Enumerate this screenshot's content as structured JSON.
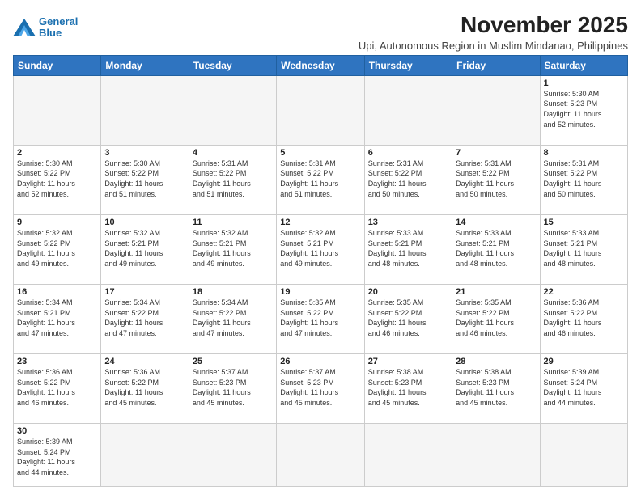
{
  "logo": {
    "line1": "General",
    "line2": "Blue"
  },
  "title": "November 2025",
  "subtitle": "Upi, Autonomous Region in Muslim Mindanao, Philippines",
  "weekdays": [
    "Sunday",
    "Monday",
    "Tuesday",
    "Wednesday",
    "Thursday",
    "Friday",
    "Saturday"
  ],
  "weeks": [
    [
      {
        "day": "",
        "info": ""
      },
      {
        "day": "",
        "info": ""
      },
      {
        "day": "",
        "info": ""
      },
      {
        "day": "",
        "info": ""
      },
      {
        "day": "",
        "info": ""
      },
      {
        "day": "",
        "info": ""
      },
      {
        "day": "1",
        "info": "Sunrise: 5:30 AM\nSunset: 5:23 PM\nDaylight: 11 hours\nand 52 minutes."
      }
    ],
    [
      {
        "day": "2",
        "info": "Sunrise: 5:30 AM\nSunset: 5:22 PM\nDaylight: 11 hours\nand 52 minutes."
      },
      {
        "day": "3",
        "info": "Sunrise: 5:30 AM\nSunset: 5:22 PM\nDaylight: 11 hours\nand 51 minutes."
      },
      {
        "day": "4",
        "info": "Sunrise: 5:31 AM\nSunset: 5:22 PM\nDaylight: 11 hours\nand 51 minutes."
      },
      {
        "day": "5",
        "info": "Sunrise: 5:31 AM\nSunset: 5:22 PM\nDaylight: 11 hours\nand 51 minutes."
      },
      {
        "day": "6",
        "info": "Sunrise: 5:31 AM\nSunset: 5:22 PM\nDaylight: 11 hours\nand 50 minutes."
      },
      {
        "day": "7",
        "info": "Sunrise: 5:31 AM\nSunset: 5:22 PM\nDaylight: 11 hours\nand 50 minutes."
      },
      {
        "day": "8",
        "info": "Sunrise: 5:31 AM\nSunset: 5:22 PM\nDaylight: 11 hours\nand 50 minutes."
      }
    ],
    [
      {
        "day": "9",
        "info": "Sunrise: 5:32 AM\nSunset: 5:22 PM\nDaylight: 11 hours\nand 49 minutes."
      },
      {
        "day": "10",
        "info": "Sunrise: 5:32 AM\nSunset: 5:21 PM\nDaylight: 11 hours\nand 49 minutes."
      },
      {
        "day": "11",
        "info": "Sunrise: 5:32 AM\nSunset: 5:21 PM\nDaylight: 11 hours\nand 49 minutes."
      },
      {
        "day": "12",
        "info": "Sunrise: 5:32 AM\nSunset: 5:21 PM\nDaylight: 11 hours\nand 49 minutes."
      },
      {
        "day": "13",
        "info": "Sunrise: 5:33 AM\nSunset: 5:21 PM\nDaylight: 11 hours\nand 48 minutes."
      },
      {
        "day": "14",
        "info": "Sunrise: 5:33 AM\nSunset: 5:21 PM\nDaylight: 11 hours\nand 48 minutes."
      },
      {
        "day": "15",
        "info": "Sunrise: 5:33 AM\nSunset: 5:21 PM\nDaylight: 11 hours\nand 48 minutes."
      }
    ],
    [
      {
        "day": "16",
        "info": "Sunrise: 5:34 AM\nSunset: 5:21 PM\nDaylight: 11 hours\nand 47 minutes."
      },
      {
        "day": "17",
        "info": "Sunrise: 5:34 AM\nSunset: 5:22 PM\nDaylight: 11 hours\nand 47 minutes."
      },
      {
        "day": "18",
        "info": "Sunrise: 5:34 AM\nSunset: 5:22 PM\nDaylight: 11 hours\nand 47 minutes."
      },
      {
        "day": "19",
        "info": "Sunrise: 5:35 AM\nSunset: 5:22 PM\nDaylight: 11 hours\nand 47 minutes."
      },
      {
        "day": "20",
        "info": "Sunrise: 5:35 AM\nSunset: 5:22 PM\nDaylight: 11 hours\nand 46 minutes."
      },
      {
        "day": "21",
        "info": "Sunrise: 5:35 AM\nSunset: 5:22 PM\nDaylight: 11 hours\nand 46 minutes."
      },
      {
        "day": "22",
        "info": "Sunrise: 5:36 AM\nSunset: 5:22 PM\nDaylight: 11 hours\nand 46 minutes."
      }
    ],
    [
      {
        "day": "23",
        "info": "Sunrise: 5:36 AM\nSunset: 5:22 PM\nDaylight: 11 hours\nand 46 minutes."
      },
      {
        "day": "24",
        "info": "Sunrise: 5:36 AM\nSunset: 5:22 PM\nDaylight: 11 hours\nand 45 minutes."
      },
      {
        "day": "25",
        "info": "Sunrise: 5:37 AM\nSunset: 5:23 PM\nDaylight: 11 hours\nand 45 minutes."
      },
      {
        "day": "26",
        "info": "Sunrise: 5:37 AM\nSunset: 5:23 PM\nDaylight: 11 hours\nand 45 minutes."
      },
      {
        "day": "27",
        "info": "Sunrise: 5:38 AM\nSunset: 5:23 PM\nDaylight: 11 hours\nand 45 minutes."
      },
      {
        "day": "28",
        "info": "Sunrise: 5:38 AM\nSunset: 5:23 PM\nDaylight: 11 hours\nand 45 minutes."
      },
      {
        "day": "29",
        "info": "Sunrise: 5:39 AM\nSunset: 5:24 PM\nDaylight: 11 hours\nand 44 minutes."
      }
    ],
    [
      {
        "day": "30",
        "info": "Sunrise: 5:39 AM\nSunset: 5:24 PM\nDaylight: 11 hours\nand 44 minutes."
      },
      {
        "day": "",
        "info": ""
      },
      {
        "day": "",
        "info": ""
      },
      {
        "day": "",
        "info": ""
      },
      {
        "day": "",
        "info": ""
      },
      {
        "day": "",
        "info": ""
      },
      {
        "day": "",
        "info": ""
      }
    ]
  ]
}
